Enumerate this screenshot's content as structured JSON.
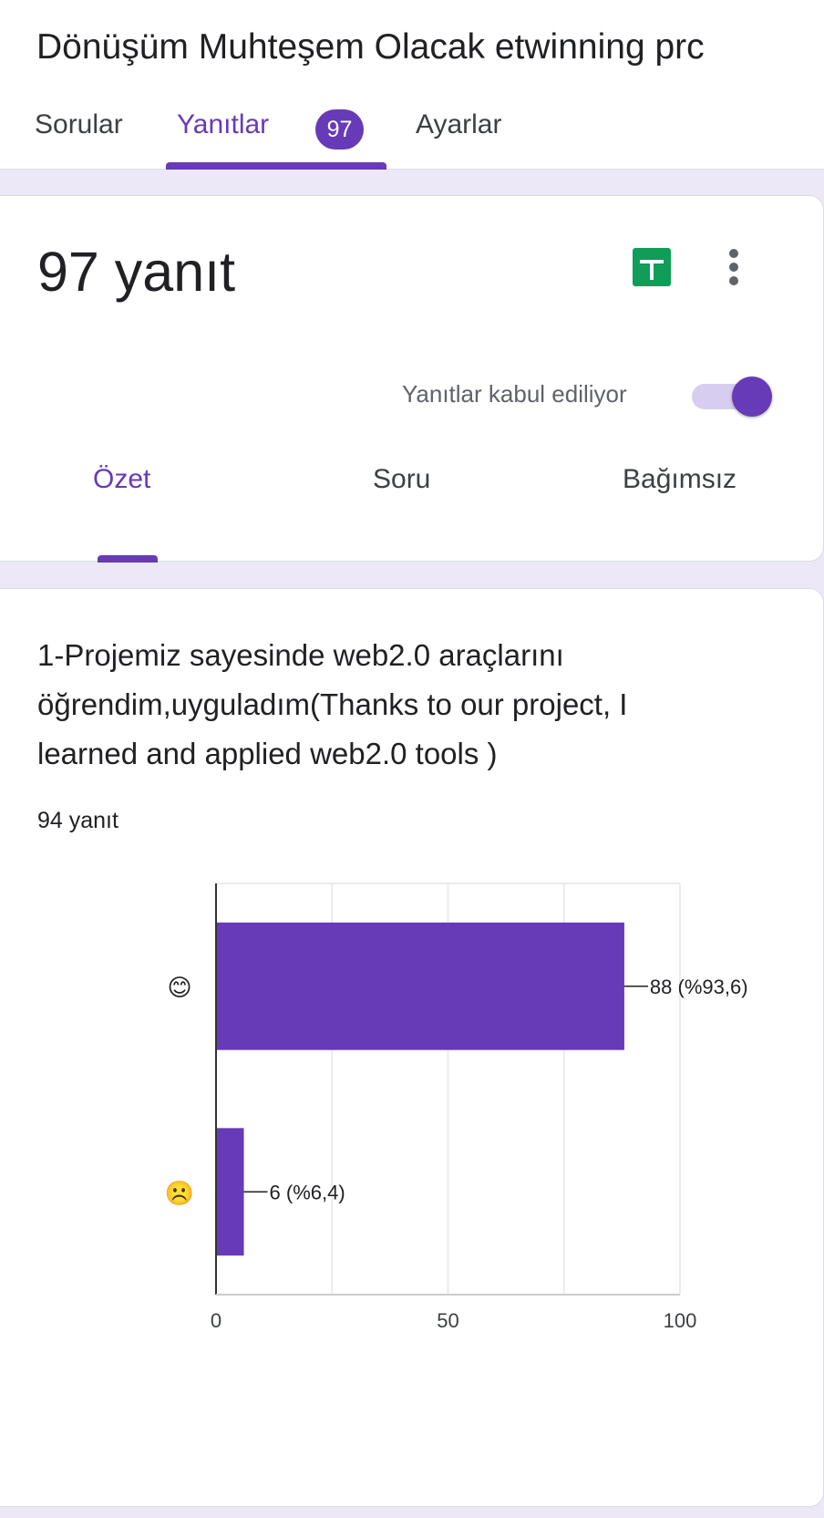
{
  "form": {
    "title": "Dönüşüm Muhteşem Olacak etwinning prc"
  },
  "top_tabs": [
    {
      "label": "Sorular",
      "active": false
    },
    {
      "label": "Yanıtlar",
      "active": true,
      "badge": "97"
    },
    {
      "label": "Ayarlar",
      "active": false
    }
  ],
  "summary": {
    "response_count": "97 yanıt",
    "accepting_label": "Yanıtlar kabul ediliyor",
    "accepting": true,
    "sub_tabs": [
      {
        "label": "Özet",
        "active": true
      },
      {
        "label": "Soru",
        "active": false
      },
      {
        "label": "Bağımsız",
        "active": false
      }
    ]
  },
  "question": {
    "title": "1-Projemiz sayesinde web2.0 araçlarını öğrendim,uyguladım(Thanks to our project, I learned and applied web2.0 tools )",
    "response_count": "94 yanıt"
  },
  "chart_data": {
    "type": "bar",
    "orientation": "horizontal",
    "categories": [
      "😊",
      "☹️"
    ],
    "values": [
      88,
      6
    ],
    "value_labels": [
      "88 (%93,6)",
      "6 (%6,4)"
    ],
    "xlim": [
      0,
      100
    ],
    "xticks": [
      0,
      50,
      100
    ],
    "grid": true,
    "color": "#673ab7"
  },
  "colors": {
    "accent": "#673ab7",
    "sheets": "#0f9d58",
    "background": "#ece8f8"
  }
}
